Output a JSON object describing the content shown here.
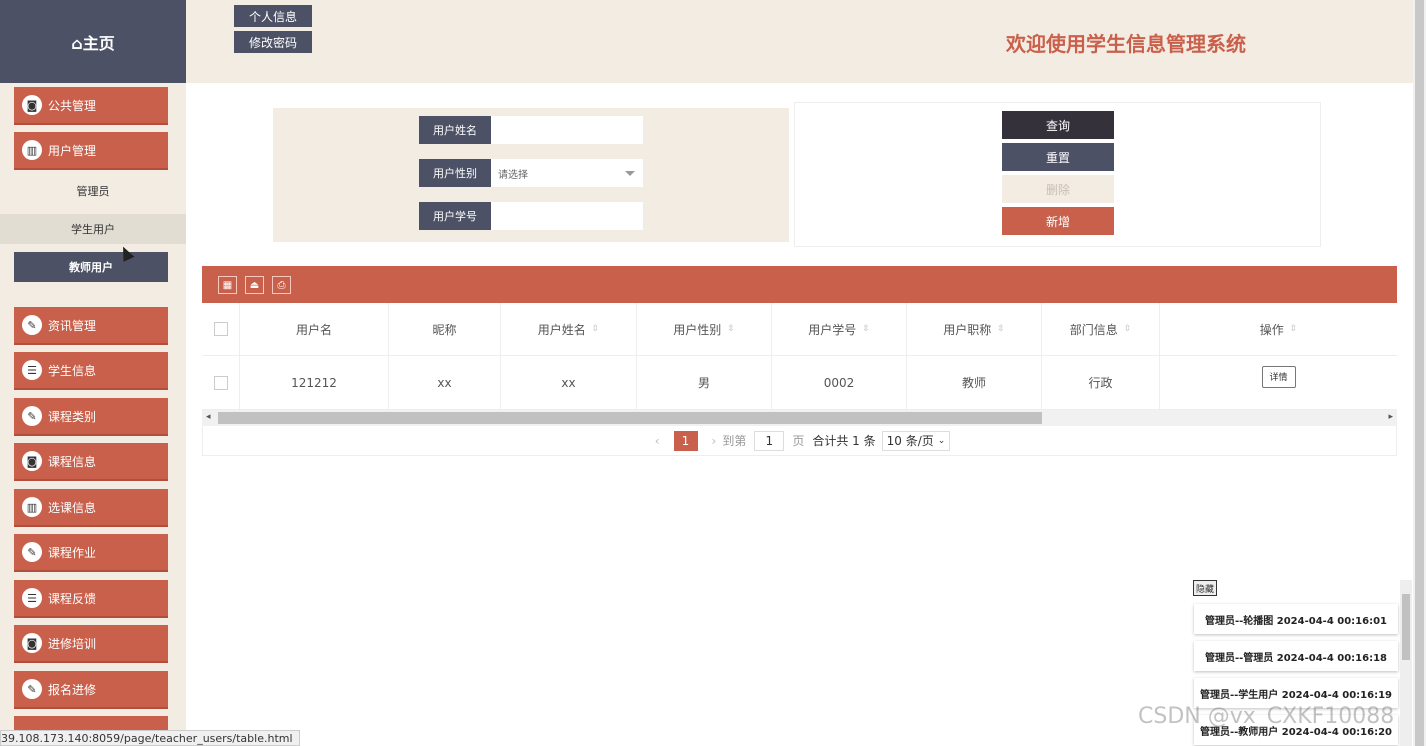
{
  "home": {
    "icon": "home-icon",
    "label": "⌂主页"
  },
  "header": {
    "buttons": [
      "个人信息",
      "修改密码"
    ],
    "title": "欢迎使用学生信息管理系统"
  },
  "sidebar": {
    "items": [
      {
        "label": "公共管理",
        "icon": "robot-icon"
      },
      {
        "label": "用户管理",
        "icon": "chart-icon"
      },
      {
        "label": "资讯管理",
        "icon": "edit-icon"
      },
      {
        "label": "学生信息",
        "icon": "document-icon"
      },
      {
        "label": "课程类别",
        "icon": "edit-icon"
      },
      {
        "label": "课程信息",
        "icon": "robot-icon"
      },
      {
        "label": "选课信息",
        "icon": "chart-icon"
      },
      {
        "label": "课程作业",
        "icon": "edit-icon"
      },
      {
        "label": "课程反馈",
        "icon": "document-icon"
      },
      {
        "label": "进修培训",
        "icon": "robot-icon"
      },
      {
        "label": "报名进修",
        "icon": "edit-icon"
      }
    ],
    "sub_items": [
      "管理员",
      "学生用户",
      "教师用户"
    ]
  },
  "search": {
    "name_label": "用户姓名",
    "gender_label": "用户性别",
    "gender_placeholder": "请选择",
    "id_label": "用户学号"
  },
  "actions": {
    "query": "查询",
    "reset": "重置",
    "delete": "删除",
    "add": "新增"
  },
  "table": {
    "columns": [
      "用户名",
      "昵称",
      "用户姓名",
      "用户性别",
      "用户学号",
      "用户职称",
      "部门信息",
      "操作"
    ],
    "rows": [
      {
        "username": "121212",
        "nickname": "xx",
        "name": "xx",
        "gender": "男",
        "student_id": "0002",
        "title": "教师",
        "department": "行政",
        "action": "详情"
      }
    ]
  },
  "pager": {
    "page": "1",
    "goto": "到第",
    "goto_value": "1",
    "page_suffix": "页",
    "total": "合计共 1 条",
    "page_size": "10 条/页"
  },
  "log": {
    "hide_label": "隐藏",
    "entries": [
      "管理员--轮播图 2024-04-4 00:16:01",
      "管理员--管理员 2024-04-4 00:16:18",
      "管理员--学生用户 2024-04-4 00:16:19",
      "管理员--教师用户 2024-04-4 00:16:20"
    ]
  },
  "statusbar": "39.108.173.140:8059/page/teacher_users/table.html",
  "watermark": "CSDN @vx_CXKF10088"
}
